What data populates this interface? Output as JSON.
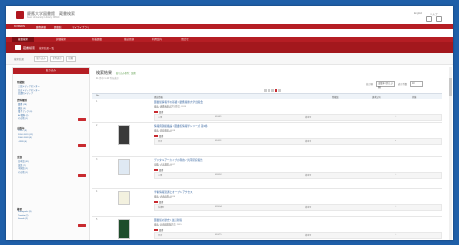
{
  "header": {
    "title": "慶應大学図書館　蔵書検索",
    "subtitle": "Keio University Library OPAC",
    "links": [
      "English",
      "ヘルプ"
    ],
    "icons": [
      "home-icon",
      "user-icon"
    ]
  },
  "utilbar": {
    "items": [
      "KOSMOS",
      "慶應義塾",
      "図書館",
      "マイライブラリ"
    ]
  },
  "nav": {
    "tabs": [
      "蔵書検索",
      "詳細検索",
      "新着図書",
      "雑誌目録",
      "利用案内",
      "問合せ"
    ]
  },
  "subbar": {
    "title": "蔵書検索",
    "meta": "検索結果一覧"
  },
  "breadcrumb": {
    "text": "検索結果",
    "buttons": [
      "絞り込み",
      "全件表示",
      "印刷"
    ]
  },
  "sidebar": {
    "header": "絞り込み",
    "sections": [
      {
        "title": "所蔵館",
        "items": [
          "三田メディアセンター",
          "日吉メディアセンター",
          "信濃町メディア"
        ]
      },
      {
        "title": "資料種別",
        "items": [
          "図書 (28)",
          "雑誌 (4)",
          "電子ブック (6)",
          "AV資料 (2)",
          "その他 (1)"
        ]
      },
      {
        "title": "出版年",
        "items": [
          "2020- (9)",
          "2010-2019 (12)",
          "2000-2009 (8)",
          "-1999 (6)"
        ]
      },
      {
        "title": "言語",
        "items": [
          "日本語 (31)",
          "英語 (7)",
          "中国語 (2)",
          "その他 (1)"
        ]
      },
      {
        "title": "著者",
        "items": [
          "Kobayashi (3)",
          "Tanaka (2)",
          "Suzuki (2)"
        ]
      }
    ]
  },
  "main": {
    "title": "検索結果",
    "filter": "絞り込み条件：図書",
    "summary": "41 件中 1-10 件を表示",
    "sort_label": "並び順",
    "sort_value": "出版年 (新しい順)",
    "count_label": "表示件数",
    "count_value": "10",
    "pager": "< 1 2 3 4 5 >",
    "columns": [
      "No.",
      "書誌情報",
      "所蔵館",
      "請求記号",
      "状態"
    ]
  },
  "results": [
    {
      "num": "1",
      "title": "図書館情報学の基礎 / 慶應義塾大学出版会",
      "line1": "東京 : 慶應義塾大学出版会, 2019",
      "line2": "ISBN 9784766425",
      "type": "図書",
      "cells": [
        "三田",
        "010/K1",
        "貸出可",
        "○"
      ]
    },
    {
      "num": "2",
      "title": "情報資源組織論 / 図書館情報学シリーズ 第3巻",
      "line1": "東京 : 勁草書房, 2018",
      "line2": "ISBN 9784326000",
      "type": "図書",
      "cells": [
        "日吉",
        "014/J3",
        "貸出中",
        "×"
      ]
    },
    {
      "num": "3",
      "title": "デジタルアーカイブの現在 / 共同研究報告",
      "line1": "京都 : 人文書院, 2017",
      "line2": "ISBN 9784409241",
      "type": "図書",
      "cells": [
        "三田",
        "018/D2",
        "貸出可",
        "○"
      ]
    },
    {
      "num": "4",
      "title": "学術情報流通とオープンアクセス",
      "line1": "東京 : 丸善出版, 2016",
      "line2": "ISBN 9784621090",
      "type": "図書",
      "cells": [
        "信濃町",
        "020/G4",
        "貸出可",
        "○"
      ]
    },
    {
      "num": "5",
      "title": "図書館の歴史 / 改訂新版",
      "line1": "東京 : 日本図書館協会, 2015",
      "line2": "ISBN 9784820415",
      "type": "図書",
      "cells": [
        "日吉",
        "010/T5",
        "貸出可",
        "○"
      ]
    }
  ],
  "colors": {
    "brand_red": "#b51e24",
    "dark_red": "#7d0f14",
    "link_blue": "#2f5f9c",
    "desktop_blue": "#1f5fa8"
  }
}
